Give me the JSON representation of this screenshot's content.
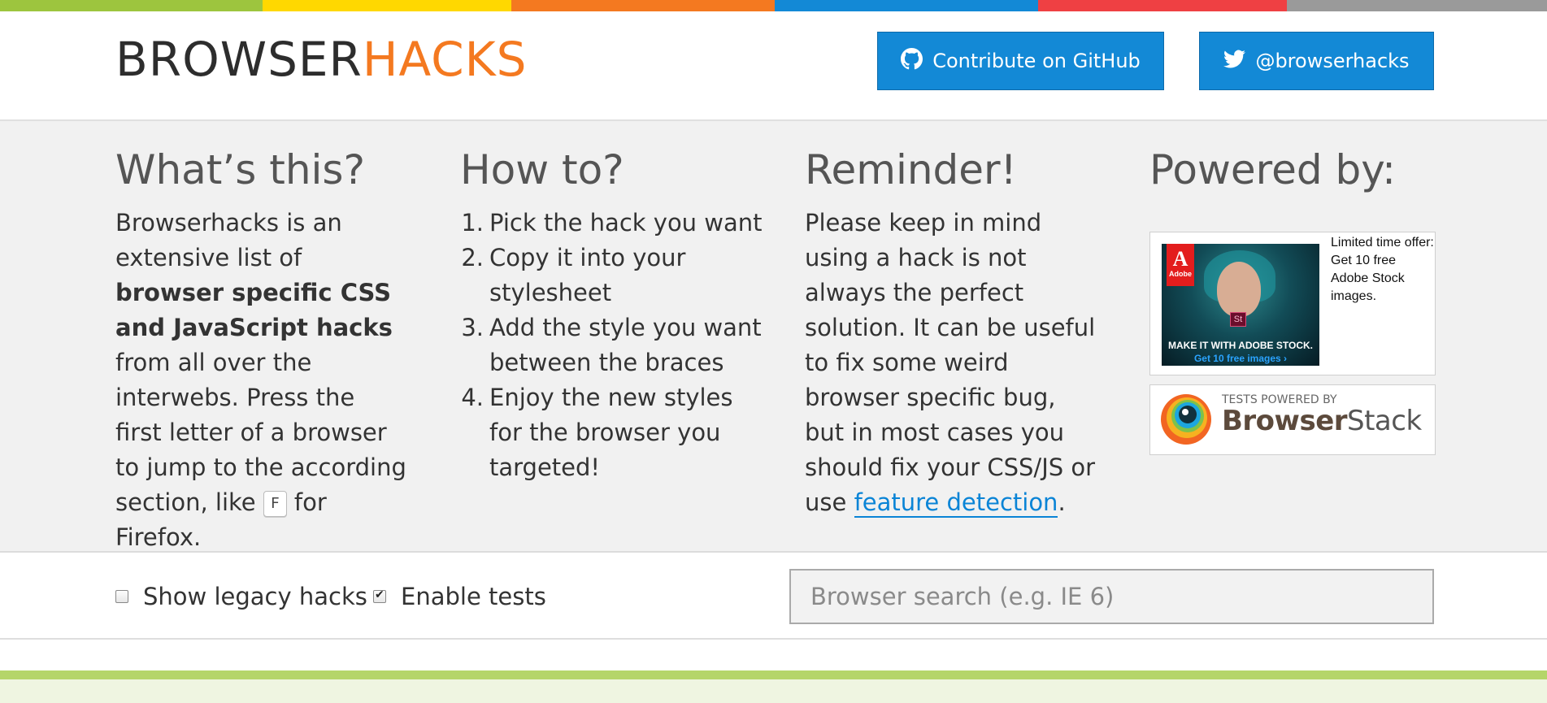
{
  "colors": {
    "stripe": [
      "#9dc53e",
      "#ffd800",
      "#f47920",
      "#1389d6",
      "#ef4043",
      "#9a9a9a"
    ],
    "accent_blue": "#1389d6",
    "logo_orange": "#f47920",
    "green_section": "#b5d56a"
  },
  "header": {
    "logo_part1": "BROWSER",
    "logo_part2": "HACKS",
    "github_button": {
      "label": "Contribute on GitHub",
      "icon": "github-icon"
    },
    "twitter_button": {
      "label": "@browserhacks",
      "icon": "twitter-icon"
    }
  },
  "info": {
    "whats_this": {
      "title": "What’s this?",
      "text_1": "Browserhacks is an extensive list of ",
      "text_bold": "browser specific CSS and JavaScript hacks",
      "text_2": " from all over the interwebs. Press the first letter of a browser to jump to the according section, like ",
      "key": "F",
      "text_3": " for Firefox."
    },
    "how_to": {
      "title": "How to?",
      "steps": [
        {
          "num": "1.",
          "text": "Pick the hack you want"
        },
        {
          "num": "2.",
          "text": "Copy it into your stylesheet"
        },
        {
          "num": "3.",
          "text": "Add the style you want between the braces"
        },
        {
          "num": "4.",
          "text": "Enjoy the new styles for the browser you targeted!"
        }
      ]
    },
    "reminder": {
      "title": "Reminder!",
      "text": "Please keep in mind using a hack is not always the perfect solution. It can be useful to fix some weird browser specific bug, but in most cases you should fix your CSS/JS or use ",
      "link": "feature detection",
      "text_end": "."
    },
    "powered_by": {
      "title": "Powered by:",
      "ad": {
        "brand": "Adobe",
        "headline": "MAKE IT WITH ADOBE STOCK.",
        "cta": "Get 10 free images ›",
        "st_badge": "St",
        "copy": "Limited time offer: Get 10 free Adobe Stock images."
      },
      "browserstack": {
        "small": "TESTS POWERED BY",
        "brand_bold": "Browser",
        "brand_regular": "Stack"
      }
    }
  },
  "options": {
    "legacy": {
      "label": "Show legacy hacks",
      "checked": false
    },
    "tests": {
      "label": "Enable tests",
      "checked": true
    },
    "search_placeholder": "Browser search (e.g. IE 6)"
  }
}
